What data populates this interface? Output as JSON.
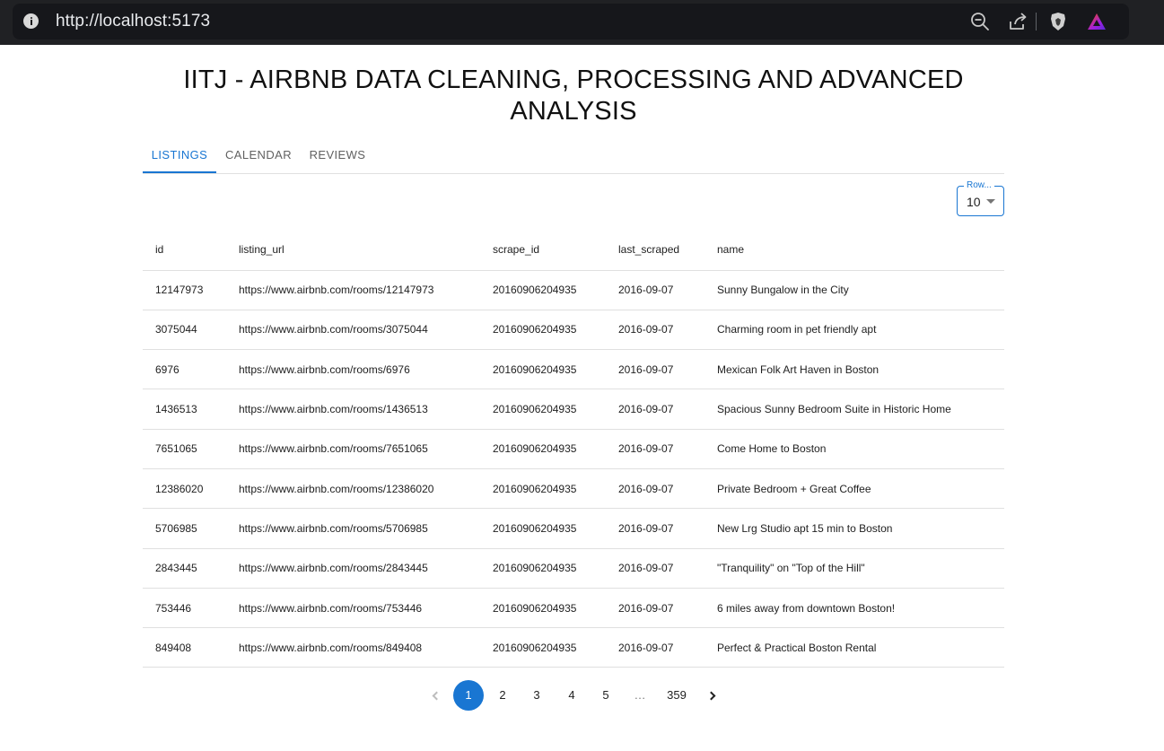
{
  "browser": {
    "url": "http://localhost:5173",
    "icons": [
      "info-icon",
      "zoom-out-icon",
      "share-icon",
      "brave-shield-icon",
      "brave-rewards-icon"
    ]
  },
  "page": {
    "title_line1": "IITJ - AIRBNB DATA CLEANING, PROCESSING AND ADVANCED",
    "title_line2": "ANALYSIS",
    "accent_color": "#1976d2"
  },
  "tabs": [
    {
      "label": "LISTINGS",
      "active": true
    },
    {
      "label": "CALENDAR",
      "active": false
    },
    {
      "label": "REVIEWS",
      "active": false
    }
  ],
  "rows_per_page": {
    "label": "Row...",
    "value": "10"
  },
  "table": {
    "columns": [
      "id",
      "listing_url",
      "scrape_id",
      "last_scraped",
      "name"
    ],
    "rows": [
      [
        "12147973",
        "https://www.airbnb.com/rooms/12147973",
        "20160906204935",
        "2016-09-07",
        "Sunny Bungalow in the City"
      ],
      [
        "3075044",
        "https://www.airbnb.com/rooms/3075044",
        "20160906204935",
        "2016-09-07",
        "Charming room in pet friendly apt"
      ],
      [
        "6976",
        "https://www.airbnb.com/rooms/6976",
        "20160906204935",
        "2016-09-07",
        "Mexican Folk Art Haven in Boston"
      ],
      [
        "1436513",
        "https://www.airbnb.com/rooms/1436513",
        "20160906204935",
        "2016-09-07",
        "Spacious Sunny Bedroom Suite in Historic Home"
      ],
      [
        "7651065",
        "https://www.airbnb.com/rooms/7651065",
        "20160906204935",
        "2016-09-07",
        "Come Home to Boston"
      ],
      [
        "12386020",
        "https://www.airbnb.com/rooms/12386020",
        "20160906204935",
        "2016-09-07",
        "Private Bedroom + Great Coffee"
      ],
      [
        "5706985",
        "https://www.airbnb.com/rooms/5706985",
        "20160906204935",
        "2016-09-07",
        "New Lrg Studio apt 15 min to Boston"
      ],
      [
        "2843445",
        "https://www.airbnb.com/rooms/2843445",
        "20160906204935",
        "2016-09-07",
        "\"Tranquility\" on \"Top of the Hill\""
      ],
      [
        "753446",
        "https://www.airbnb.com/rooms/753446",
        "20160906204935",
        "2016-09-07",
        "6 miles away from downtown Boston!"
      ],
      [
        "849408",
        "https://www.airbnb.com/rooms/849408",
        "20160906204935",
        "2016-09-07",
        "Perfect & Practical Boston Rental"
      ]
    ]
  },
  "pagination": {
    "pages": [
      "1",
      "2",
      "3",
      "4",
      "5"
    ],
    "ellipsis": "…",
    "last_page": "359",
    "current": "1"
  }
}
